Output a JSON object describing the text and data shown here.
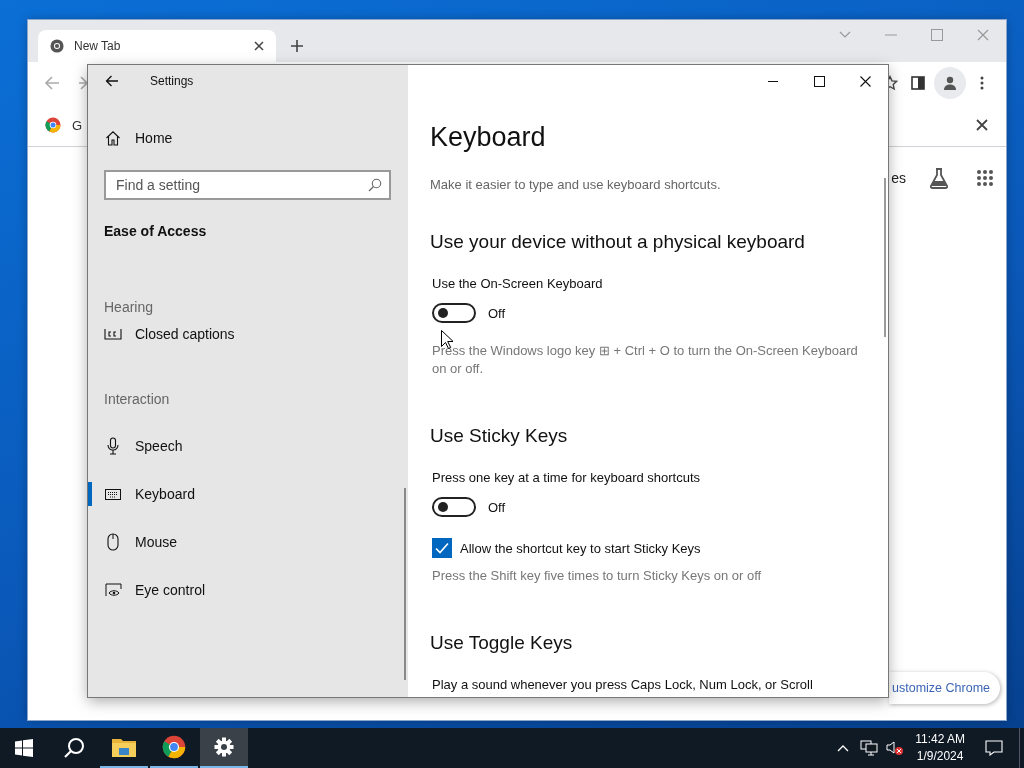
{
  "browser": {
    "tabs": [
      {
        "title": "New Tab",
        "selected": true
      }
    ],
    "bookmarks": [
      {
        "label": "G"
      }
    ],
    "page_text": "es",
    "customize_button": "ustomize Chrome"
  },
  "settings": {
    "window": {
      "title": "Settings"
    },
    "home": {
      "label": "Home",
      "kind": "home",
      "selected": false
    },
    "search": {
      "placeholder": "Find a setting"
    },
    "category": "Ease of Access",
    "nav_groups": [
      {
        "heading": "Hearing",
        "items": [
          {
            "label": "Closed captions",
            "kind": "captions",
            "selected": false
          }
        ]
      },
      {
        "heading": "Interaction",
        "items": [
          {
            "label": "Speech",
            "kind": "speech",
            "selected": false
          },
          {
            "label": "Keyboard",
            "kind": "keyboard",
            "selected": true
          },
          {
            "label": "Mouse",
            "kind": "mouse",
            "selected": false
          },
          {
            "label": "Eye control",
            "kind": "eye",
            "selected": false
          }
        ]
      }
    ],
    "page": {
      "title": "Keyboard",
      "subtitle": "Make it easier to type and use keyboard shortcuts.",
      "sections": [
        {
          "heading": "Use your device without a physical keyboard",
          "settings": [
            {
              "kind": "toggle",
              "label": "Use the On-Screen Keyboard",
              "on": false,
              "state_text": "Off"
            },
            {
              "kind": "note",
              "text": "Press the Windows logo key ⊞ + Ctrl + O to turn the On-Screen Keyboard on or off."
            }
          ]
        },
        {
          "heading": "Use Sticky Keys",
          "settings": [
            {
              "kind": "toggle",
              "label": "Press one key at a time for keyboard shortcuts",
              "on": false,
              "state_text": "Off"
            },
            {
              "kind": "checkbox",
              "label": "Allow the shortcut key to start Sticky Keys",
              "checked": true
            },
            {
              "kind": "note",
              "text": "Press the Shift key five times to turn Sticky Keys on or off"
            }
          ]
        },
        {
          "heading": "Use Toggle Keys",
          "settings": [
            {
              "kind": "label",
              "text": "Play a sound whenever you press Caps Lock, Num Lock, or Scroll"
            }
          ]
        }
      ]
    }
  },
  "taskbar": {
    "apps": [
      {
        "kind": "start",
        "running": false,
        "selected": false
      },
      {
        "kind": "search",
        "running": false,
        "selected": false
      },
      {
        "kind": "files",
        "running": true,
        "selected": false
      },
      {
        "kind": "browser",
        "running": true,
        "selected": false
      },
      {
        "kind": "settings",
        "running": true,
        "selected": true
      }
    ],
    "clock": {
      "time": "11:42 AM",
      "date": "1/9/2024"
    }
  }
}
